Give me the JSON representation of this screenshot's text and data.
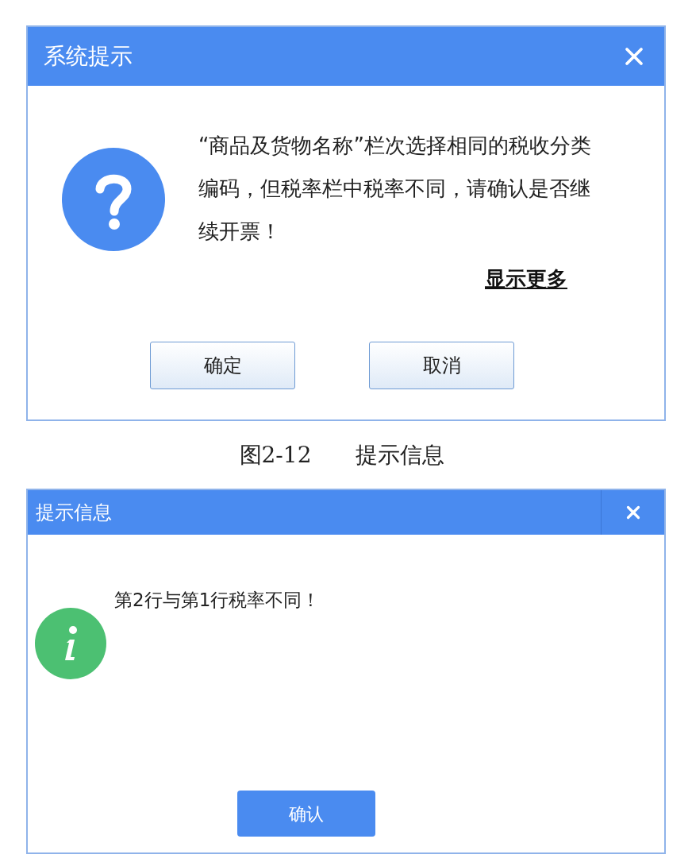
{
  "dialog_top": {
    "kind": "question",
    "title": "系统提示",
    "message": "“商品及货物名称”栏次选择相同的税收分类编码，但税率栏中税率不同，请确认是否继续开票！",
    "link": "显示更多",
    "buttons": [
      "确定",
      "取消"
    ]
  },
  "caption": {
    "number": "图2-12",
    "text": "提示信息"
  },
  "dialog_bottom": {
    "kind": "info",
    "title": "提示信息",
    "message": "第2行与第1行税率不同！",
    "buttons": [
      "确认"
    ]
  }
}
